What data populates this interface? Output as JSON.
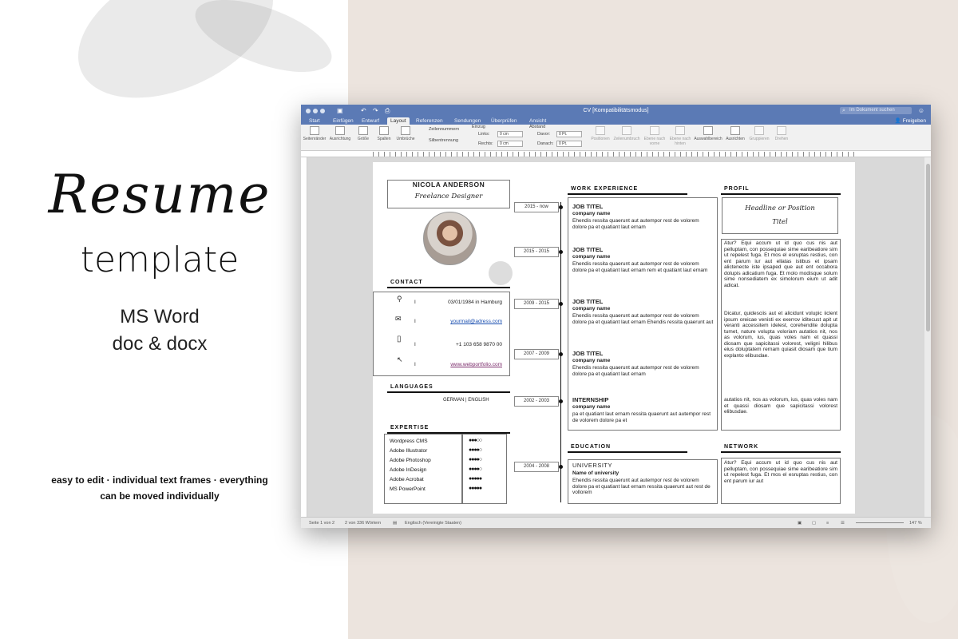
{
  "promo": {
    "script_title": "Resume",
    "subtitle": "template",
    "format_line1": "MS Word",
    "format_line2": "doc & docx",
    "features_line1": "easy to edit · individual text frames · everything",
    "features_line2": "can be moved individually"
  },
  "window": {
    "title": "CV [Kompatibilitätsmodus]",
    "search_placeholder": "Im Dokument suchen",
    "share_label": "Freigeben",
    "tabs": [
      "Start",
      "Einfügen",
      "Entwurf",
      "Layout",
      "Referenzen",
      "Sendungen",
      "Überprüfen",
      "Ansicht"
    ],
    "active_tab": "Layout",
    "ribbon": {
      "buttons": [
        "Seitenränder",
        "Ausrichtung",
        "Größe",
        "Spalten",
        "Umbrüche",
        "Silbentrennung",
        "Positionen",
        "Zeilenumbruch",
        "Ebene nach vorne",
        "Ebene nach hinten",
        "Auswahlbereich",
        "Ausrichten",
        "Gruppieren",
        "Drehen"
      ],
      "line_numbers": "Zeilennummern",
      "indent_label": "Einzug",
      "spacing_label": "Abstand",
      "left_label": "Links:",
      "right_label": "Rechts:",
      "before_label": "Davor:",
      "after_label": "Danach:",
      "left_value": "0 cm",
      "right_value": "0 cm",
      "before_value": "0 Pt.",
      "after_value": "0 Pt."
    },
    "status": {
      "page": "Seite 1 von 2",
      "words": "2 von 336 Wörtern",
      "language": "Englisch (Vereinigte Staaten)",
      "zoom": "147 %"
    }
  },
  "resume": {
    "name": "NICOLA ANDERSON",
    "role": "Freelance Designer",
    "contact_heading": "CONTACT",
    "contact": [
      {
        "icon": "location-pin-icon",
        "sep": "I",
        "value": "03/01/1984 in Hamburg"
      },
      {
        "icon": "envelope-icon",
        "sep": "I",
        "value": "yourmail@adress.com"
      },
      {
        "icon": "phone-icon",
        "sep": "I",
        "value": "+1 103 658 9870 00"
      },
      {
        "icon": "cursor-icon",
        "sep": "I",
        "value": "www.webportfolio.com"
      }
    ],
    "languages_heading": "LANGUAGES",
    "languages": "GERMAN | ENGLISH",
    "expertise_heading": "EXPERTISE",
    "skills": [
      {
        "name": "Wordpress CMS",
        "rating": 3
      },
      {
        "name": "Adobe Illustrator",
        "rating": 4
      },
      {
        "name": "Adobe Photoshop",
        "rating": 4
      },
      {
        "name": "Adobe InDesign",
        "rating": 4
      },
      {
        "name": "Adobe Acrobat",
        "rating": 5
      },
      {
        "name": "MS PowerPoint",
        "rating": 5
      }
    ],
    "work_heading": "WORK EXPERIENCE",
    "jobs": [
      {
        "date": "2015 - now",
        "title": "JOB TITEL",
        "company": "company name",
        "desc": "Ehendis ressita quaerunt aut autempor rest de volorem dolore pa et quatiant laut ernam"
      },
      {
        "date": "2015 - 2015",
        "title": "JOB TITEL",
        "company": "company name",
        "desc": "Ehendis ressita quaerunt aut autempor rest de volorem dolore pa et quatiant laut ernam rem et quatiant laut ernam"
      },
      {
        "date": "2009 - 2015",
        "title": "JOB TITEL",
        "company": "company name",
        "desc": "Ehendis ressita quaerunt aut autempor rest de volorem dolore pa et quatiant laut ernam Ehendis ressita quaerunt aut"
      },
      {
        "date": "2007 - 2009",
        "title": "JOB TITEL",
        "company": "company name",
        "desc": "Ehendis ressita quaerunt aut autempor rest de volorem dolore pa et quatiant laut ernam"
      },
      {
        "date": "2002 - 2003",
        "title": "INTERNSHIP",
        "company": "company name",
        "desc": "pa et quatiant laut ernam ressita quaerunt aut autempor rest de volorem dolore pa et"
      }
    ],
    "education_heading": "EDUCATION",
    "education": {
      "date": "2004 - 2008",
      "title": "UNIVERSITY",
      "company": "Name of university",
      "desc": "Ehendis ressita quaerunt aut autempor rest de volorem dolore pa et quatiant laut ernam ressita quaerunt aut rest de vollorem"
    },
    "profile_heading": "PROFIL",
    "profile_headline": "Headline or Position Titel",
    "profile_text1": "Atur? Equi accum ut id quo cus nis aut pelluptam, con possequiae sime earibeatiore sim ut repelest fuga. Et mos el esruptas restius, con ent parum iur aut ellatas istibus et ipsam alictenecte iste ipsaped que aut ent occabora dolupis adicatium fuga. Et molo modisque solum sime nonsediatem ex simolorum eium ut adit adicat.",
    "profile_text2": "Dicatur, quidesciis aut et alicidunt volupic iiclent ipsum oreicae venisti ex exerrov iditecust apit ut veranti accessitem idelest, corehendite dolupta tumet, nature volupta voloriam autatios nit, nos as volorum, ius, quas voles nam et quassi diosam que sapicitassi volorest, veligni hilibus eius doluptatem rernam quiasit diosam que tium explanto elibusdae.",
    "profile_text3": "autatios nit, nos as volorum, ius, quas voles nam et quassi diosam que sapicitassi volorest elibusdae.",
    "network_heading": "NETWORK",
    "network_text": "Atur? Equi accum ut id quo cus nis aut pelluptam, con possequiae sime earibeatiore sim ut repelest fuga. Et mos el esruptas restius, con ent parum iur aut"
  }
}
